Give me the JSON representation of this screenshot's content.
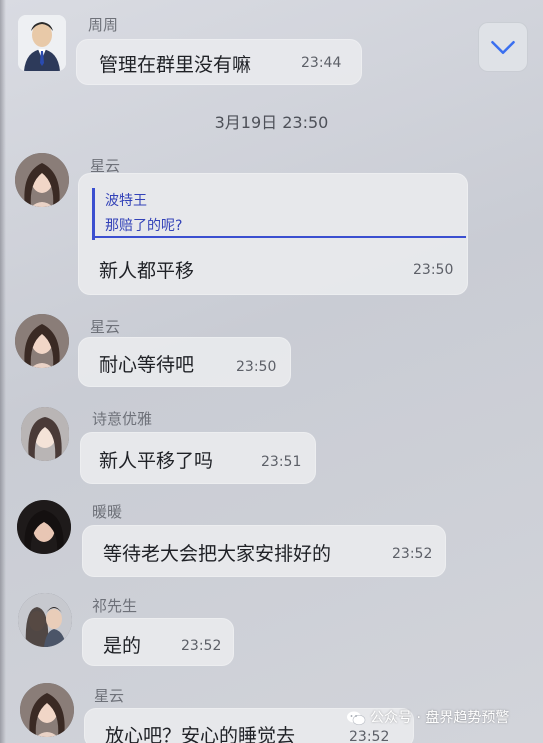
{
  "chat": {
    "date_separator": "3月19日 23:50",
    "messages": [
      {
        "sender": "周周",
        "text": "管理在群里没有嘛",
        "time": "23:44",
        "avatar": "avatar-man-suit"
      },
      {
        "sender": "星云",
        "quote_author": "波特王",
        "quote_text": "那赔了的呢?",
        "text": "新人都平移",
        "time": "23:50",
        "avatar": "avatar-woman"
      },
      {
        "sender": "星云",
        "text": "耐心等待吧",
        "time": "23:50",
        "avatar": "avatar-woman"
      },
      {
        "sender": "诗意优雅",
        "text": "新人平移了吗",
        "time": "23:51",
        "avatar": "avatar-cartoon-girl"
      },
      {
        "sender": "暖暖",
        "text": "等待老大会把大家安排好的",
        "time": "23:52",
        "avatar": "avatar-woman"
      },
      {
        "sender": "祁先生",
        "text": "是的",
        "time": "23:52",
        "avatar": "avatar-couple"
      },
      {
        "sender": "星云",
        "text": "放心吧？安心的睡觉去",
        "time": "23:52",
        "avatar": "avatar-woman"
      }
    ]
  },
  "scroll_button": {
    "icon": "chevron-down-icon"
  },
  "watermark": {
    "text": "公众号 · 盘界趋势预警",
    "icon": "wechat-icon"
  },
  "colors": {
    "quote_accent": "#3b4fd0",
    "bubble": "#e8e9ec",
    "background": "#d2d4da"
  }
}
